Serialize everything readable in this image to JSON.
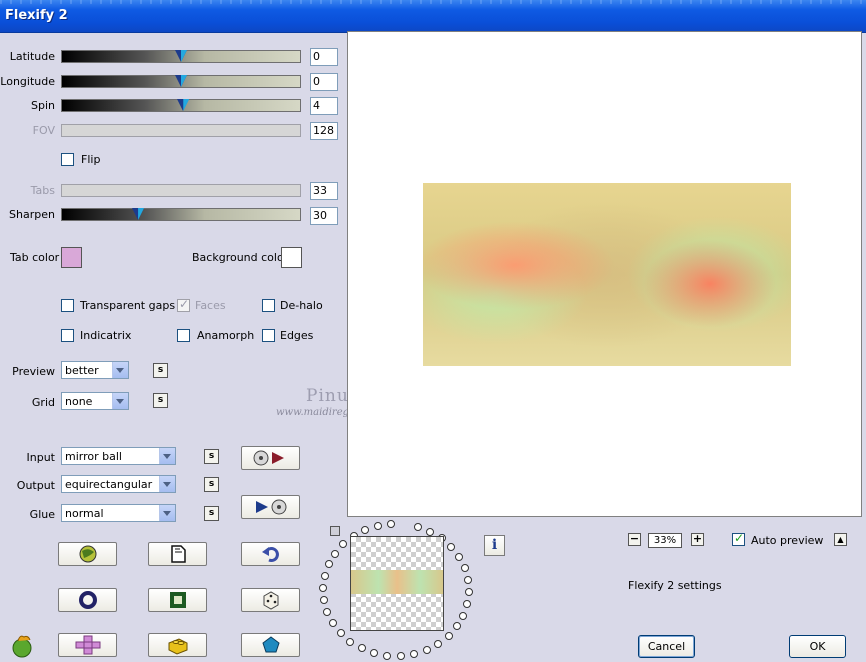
{
  "window": {
    "title": "Flexify 2"
  },
  "sliders": {
    "latitude": {
      "label": "Latitude",
      "value": "0",
      "fraction": 0.5,
      "enabled": true
    },
    "longitude": {
      "label": "Longitude",
      "value": "0",
      "fraction": 0.5,
      "enabled": true
    },
    "spin": {
      "label": "Spin",
      "value": "4",
      "fraction": 0.51,
      "enabled": true
    },
    "fov": {
      "label": "FOV",
      "value": "128",
      "fraction": 0,
      "enabled": false
    },
    "tabs": {
      "label": "Tabs",
      "value": "33",
      "fraction": 0,
      "enabled": false
    },
    "sharpen": {
      "label": "Sharpen",
      "value": "30",
      "fraction": 0.31,
      "enabled": true
    }
  },
  "flip": {
    "label": "Flip",
    "checked": false
  },
  "colors": {
    "tab_label": "Tab color",
    "tab_color": "#d9a8d8",
    "background_label": "Background color",
    "background_color": "#ffffff"
  },
  "options": {
    "transparent_gaps": {
      "label": "Transparent gaps",
      "checked": false
    },
    "faces": {
      "label": "Faces",
      "checked": true,
      "enabled": false
    },
    "de_halo": {
      "label": "De-halo",
      "checked": false
    },
    "indicatrix": {
      "label": "Indicatrix",
      "checked": false
    },
    "anamorph": {
      "label": "Anamorph",
      "checked": false
    },
    "edges": {
      "label": "Edges",
      "checked": false
    }
  },
  "dropdowns": {
    "preview": {
      "label": "Preview",
      "value": "better"
    },
    "grid": {
      "label": "Grid",
      "value": "none"
    },
    "input": {
      "label": "Input",
      "value": "mirror ball"
    },
    "output": {
      "label": "Output",
      "value": "equirectangular"
    },
    "glue": {
      "label": "Glue",
      "value": "normal"
    }
  },
  "small_button_label": "s",
  "watermark": {
    "name": "Pinuccia",
    "url": "www.maidiregrafica.eu"
  },
  "zoom": {
    "minus": "−",
    "value": "33%",
    "plus": "+"
  },
  "auto_preview": {
    "label": "Auto preview",
    "checked": true
  },
  "collapse_button": "▲",
  "info_button": "i",
  "settings_label": "Flexify 2 settings",
  "buttons": {
    "cancel": "Cancel",
    "ok": "OK"
  }
}
